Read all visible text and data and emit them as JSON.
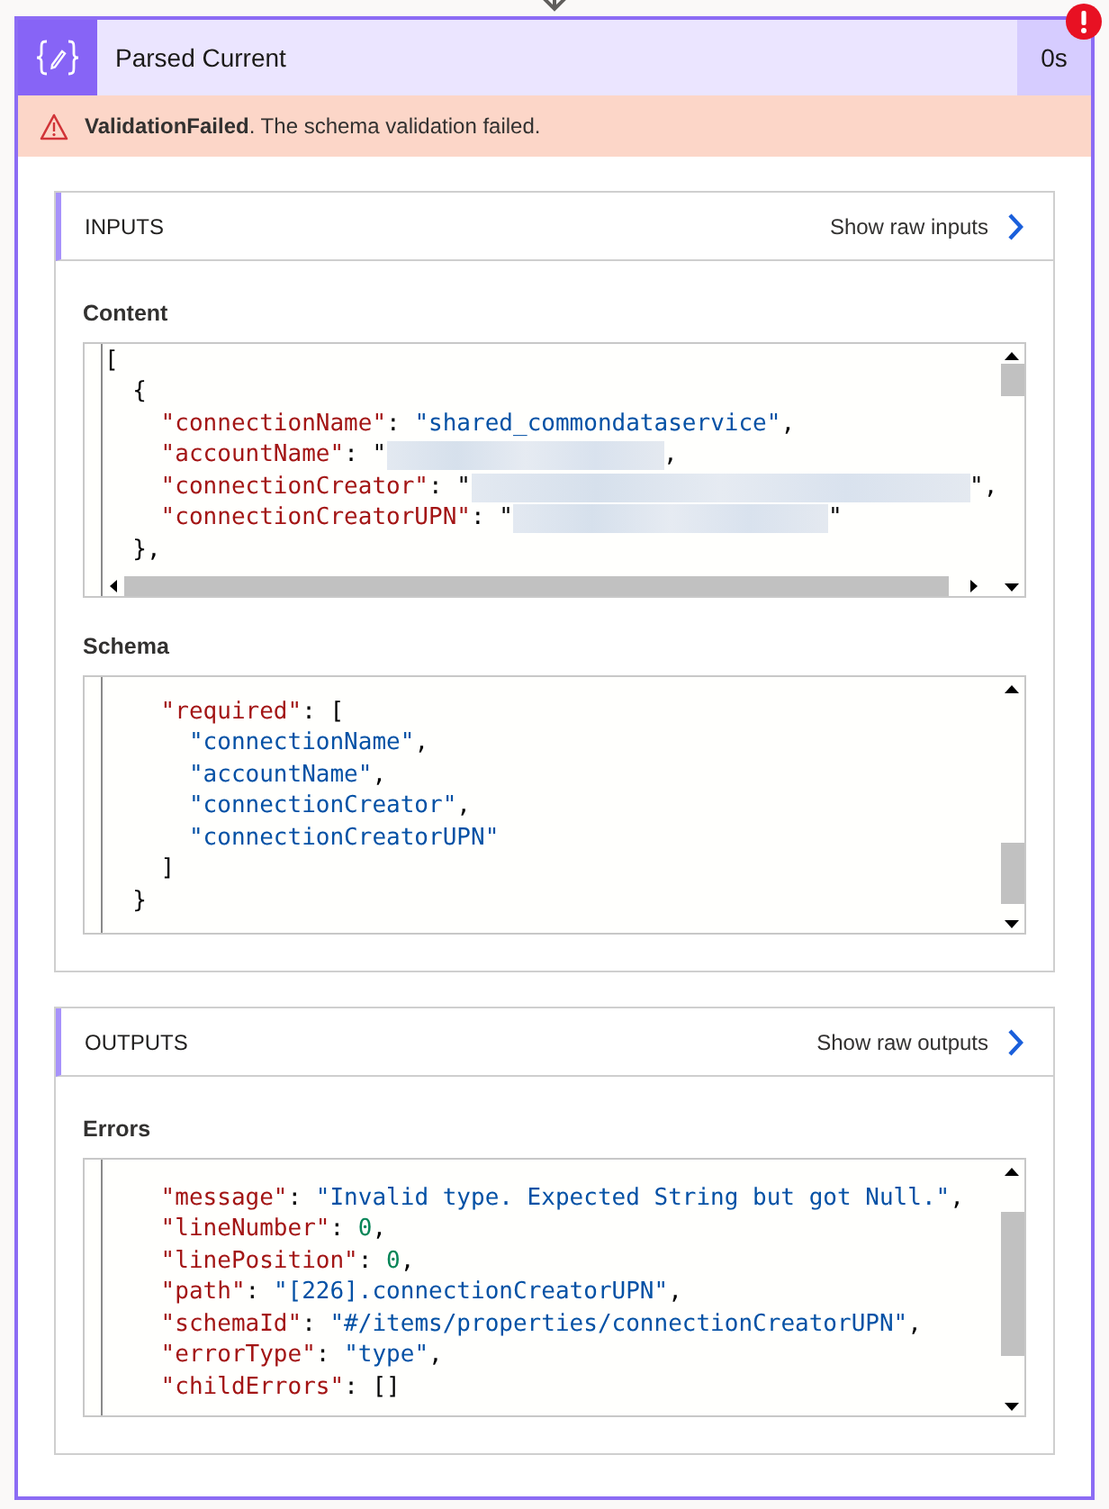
{
  "action": {
    "title": "Parsed Current",
    "duration": "0s",
    "failed": true,
    "banner": "**ValidationFailed**. The schema validation failed."
  },
  "sections": [
    {
      "heading": "INPUTS",
      "link": "Show raw inputs",
      "fields": [
        {
          "label": "Content",
          "lines": [
            {
              "tokens": [
                {
                  "kind": "punct",
                  "text": "["
                }
              ]
            },
            {
              "tokens": [
                {
                  "kind": "punct",
                  "text": "  {"
                }
              ]
            },
            {
              "tokens": [
                {
                  "kind": "key",
                  "text": "    \"connectionName\""
                },
                {
                  "kind": "punct",
                  "text": ": "
                },
                {
                  "kind": "string",
                  "text": "\"shared_commondataservice\""
                },
                {
                  "kind": "punct",
                  "text": ","
                }
              ]
            },
            {
              "tokens": [
                {
                  "kind": "key",
                  "text": "    \"accountName\""
                },
                {
                  "kind": "punct",
                  "text": ": \""
                },
                {
                  "kind": "redacted"
                },
                {
                  "kind": "punct",
                  "text": ","
                }
              ]
            },
            {
              "tokens": [
                {
                  "kind": "key",
                  "text": "    \"connectionCreator\""
                },
                {
                  "kind": "punct",
                  "text": ": \""
                },
                {
                  "kind": "redacted"
                },
                {
                  "kind": "punct",
                  "text": "\","
                }
              ]
            },
            {
              "tokens": [
                {
                  "kind": "key",
                  "text": "    \"connectionCreatorUPN\""
                },
                {
                  "kind": "punct",
                  "text": ": \""
                },
                {
                  "kind": "redacted"
                },
                {
                  "kind": "punct",
                  "text": "\""
                }
              ]
            },
            {
              "tokens": [
                {
                  "kind": "punct",
                  "text": "  },"
                }
              ]
            }
          ]
        },
        {
          "label": "Schema",
          "lines": [
            {
              "tokens": [
                {
                  "kind": "key",
                  "text": "    \"required\""
                },
                {
                  "kind": "punct",
                  "text": ": ["
                }
              ]
            },
            {
              "tokens": [
                {
                  "kind": "string",
                  "text": "      \"connectionName\""
                },
                {
                  "kind": "punct",
                  "text": ","
                }
              ]
            },
            {
              "tokens": [
                {
                  "kind": "string",
                  "text": "      \"accountName\""
                },
                {
                  "kind": "punct",
                  "text": ","
                }
              ]
            },
            {
              "tokens": [
                {
                  "kind": "string",
                  "text": "      \"connectionCreator\""
                },
                {
                  "kind": "punct",
                  "text": ","
                }
              ]
            },
            {
              "tokens": [
                {
                  "kind": "string",
                  "text": "      \"connectionCreatorUPN\""
                }
              ]
            },
            {
              "tokens": [
                {
                  "kind": "punct",
                  "text": "    ]"
                }
              ]
            },
            {
              "tokens": [
                {
                  "kind": "punct",
                  "text": "  }"
                }
              ]
            }
          ]
        }
      ]
    },
    {
      "heading": "OUTPUTS",
      "link": "Show raw outputs",
      "fields": [
        {
          "label": "Errors",
          "lines": [
            {
              "tokens": [
                {
                  "kind": "key",
                  "text": "    \"message\""
                },
                {
                  "kind": "punct",
                  "text": ": "
                },
                {
                  "kind": "string",
                  "text": "\"Invalid type. Expected String but got Null.\""
                },
                {
                  "kind": "punct",
                  "text": ","
                }
              ]
            },
            {
              "tokens": [
                {
                  "kind": "key",
                  "text": "    \"lineNumber\""
                },
                {
                  "kind": "punct",
                  "text": ": "
                },
                {
                  "kind": "number",
                  "text": "0"
                },
                {
                  "kind": "punct",
                  "text": ","
                }
              ]
            },
            {
              "tokens": [
                {
                  "kind": "key",
                  "text": "    \"linePosition\""
                },
                {
                  "kind": "punct",
                  "text": ": "
                },
                {
                  "kind": "number",
                  "text": "0"
                },
                {
                  "kind": "punct",
                  "text": ","
                }
              ]
            },
            {
              "tokens": [
                {
                  "kind": "key",
                  "text": "    \"path\""
                },
                {
                  "kind": "punct",
                  "text": ": "
                },
                {
                  "kind": "string",
                  "text": "\"[226].connectionCreatorUPN\""
                },
                {
                  "kind": "punct",
                  "text": ","
                }
              ]
            },
            {
              "tokens": [
                {
                  "kind": "key",
                  "text": "    \"schemaId\""
                },
                {
                  "kind": "punct",
                  "text": ": "
                },
                {
                  "kind": "string",
                  "text": "\"#/items/properties/connectionCreatorUPN\""
                },
                {
                  "kind": "punct",
                  "text": ","
                }
              ]
            },
            {
              "tokens": [
                {
                  "kind": "key",
                  "text": "    \"errorType\""
                },
                {
                  "kind": "punct",
                  "text": ": "
                },
                {
                  "kind": "string",
                  "text": "\"type\""
                },
                {
                  "kind": "punct",
                  "text": ","
                }
              ]
            },
            {
              "tokens": [
                {
                  "kind": "key",
                  "text": "    \"childErrors\""
                },
                {
                  "kind": "punct",
                  "text": ": []"
                }
              ]
            }
          ]
        }
      ]
    }
  ]
}
